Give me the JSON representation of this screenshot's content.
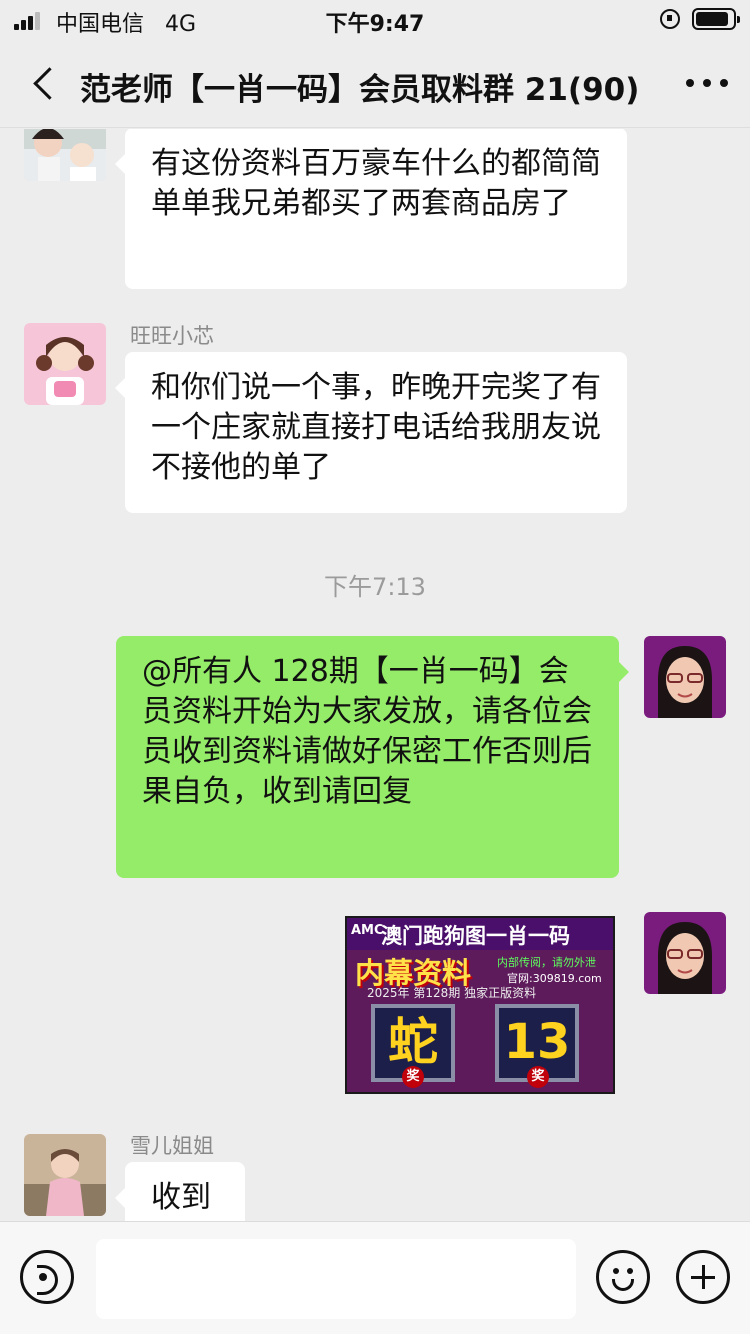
{
  "status_bar": {
    "carrier": "中国电信",
    "network": "4G",
    "time": "下午9:47",
    "battery_level": 0.9
  },
  "header": {
    "title": "范老师【一肖一码】会员取料群 21(90)",
    "back_icon": "chevron-left-icon",
    "more_icon": "ellipsis-icon"
  },
  "messages": [
    {
      "direction": "in",
      "sender": "",
      "text": "有这份资料百万豪车什么的都简简单单我兄弟都买了两套商品房了"
    },
    {
      "direction": "in",
      "sender": "旺旺小芯",
      "text": "和你们说一个事，昨晚开完奖了有一个庄家就直接打电话给我朋友说不接他的单了"
    },
    {
      "type": "time",
      "text": "下午7:13"
    },
    {
      "direction": "out",
      "text": "@所有人 128期【一肖一码】会员资料开始为大家发放，请各位会员收到资料请做好保密工作否则后果自负，收到请回复"
    },
    {
      "direction": "out",
      "type": "image",
      "image": {
        "logo": "AMC",
        "title": "澳门跑狗图一肖一码",
        "headline": "内幕资料",
        "slogan": "内部传阅，请勿外泄",
        "site": "官网:309819.com",
        "issue_line": "2025年 第128期 独家正版资料",
        "zodiac": "蛇",
        "number": "13",
        "badge": "奖"
      }
    },
    {
      "direction": "in",
      "sender": "雪儿姐姐",
      "text": "收到"
    }
  ],
  "input_bar": {
    "placeholder": "",
    "voice_icon": "voice-icon",
    "emoji_icon": "emoji-icon",
    "add_icon": "plus-icon"
  },
  "colors": {
    "background": "#ededed",
    "incoming_bubble": "#ffffff",
    "outgoing_bubble": "#95ec69",
    "timestamp": "#9b9b9b"
  }
}
